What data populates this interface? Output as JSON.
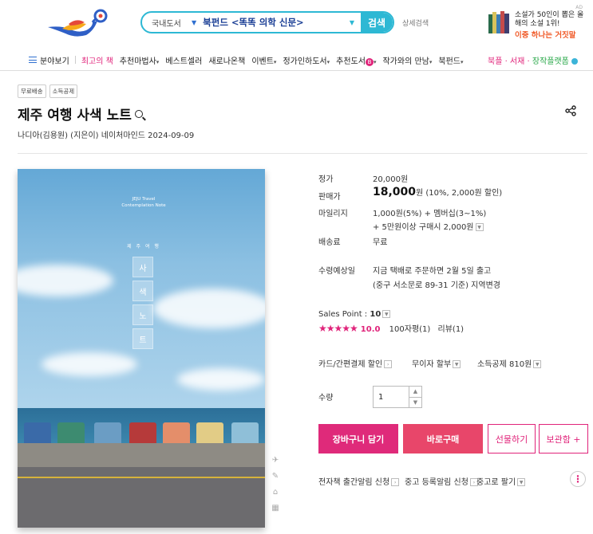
{
  "header": {
    "search_scope": "국내도서",
    "search_query": "북펀드 <똑똑 의학 신문>",
    "search_button": "검색",
    "advanced_search": "상세검색",
    "ad": {
      "tag": "AD",
      "line1": "소설가 50인이 뽑은 올해의 소설 1위!",
      "line2": "이중 하나는 거짓말"
    }
  },
  "nav": {
    "all": "분야보기",
    "items": [
      "최고의 책",
      "추천마법사",
      "베스트셀러",
      "새로나온책",
      "이벤트",
      "정가인하도서",
      "추천도서",
      "작가와의 만남",
      "북펀드"
    ],
    "right_1": "북플 · 서재 · ",
    "right_2": "장작플랫폼"
  },
  "product": {
    "tags": [
      "무료배송",
      "소득공제"
    ],
    "title": "제주 여행 사색 노트",
    "meta": "나디아(김용원) (지은이)  네이처마인드  2024-09-09"
  },
  "cover": {
    "en_title": "JEJU Travel Contemplation Note",
    "kr_title": "제 주 여 행",
    "boxes": [
      "사",
      "색",
      "노",
      "트"
    ]
  },
  "price": {
    "list_label": "정가",
    "list_value": "20,000원",
    "sale_label": "판매가",
    "sale_value": "18,000",
    "sale_unit": "원 (10%, 2,000원 할인)",
    "mileage_label": "마일리지",
    "mileage_line1": "1,000원(5%) + 멤버십(3~1%)",
    "mileage_line2": "+ 5만원이상 구매시 2,000원",
    "shipping_label": "배송료",
    "shipping_value": "무료",
    "delivery_label": "수령예상일",
    "delivery_line1": "지금 택배로 주문하면 2월 5일 출고",
    "delivery_line2": "(중구 서소문로 89-31 기준) 지역변경"
  },
  "sales": {
    "sales_point_label": "Sales Point : ",
    "sales_point_value": "10",
    "stars": "★★★★★",
    "rating": "10.0",
    "reviews_100": "100자평(1)",
    "reviews": "리뷰(1)"
  },
  "benefits": {
    "card": "카드/간편결제 할인",
    "installment": "무이자 할부",
    "tax": "소득공제 810원"
  },
  "quantity": {
    "label": "수량",
    "value": "1"
  },
  "buttons": {
    "cart": "장바구니 담기",
    "buy": "바로구매",
    "gift": "선물하기",
    "keep": "보관함 +"
  },
  "footer_links": {
    "ebook": "전자책 출간알림 신청",
    "used_alert": "중고 등록알림 신청",
    "sell_used": "중고로 팔기"
  },
  "colors": {
    "accent": "#e0237a",
    "search": "#2db8d4",
    "brand_blue": "#1a3e95"
  }
}
